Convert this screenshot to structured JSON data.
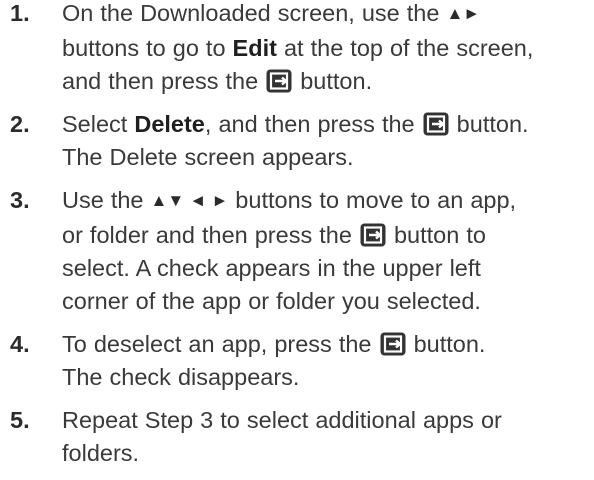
{
  "steps": [
    {
      "number": "1.",
      "lines": [
        {
          "a": "On the Downloaded screen, use the ",
          "arrows": "▲►"
        },
        {
          "a": "buttons to go to ",
          "bold": "Edit",
          "b": " at the top of the screen,"
        },
        {
          "a": "and then press the ",
          "icon": "enter-button-icon",
          "b": " button."
        }
      ]
    },
    {
      "number": "2.",
      "lines": [
        {
          "a": "Select ",
          "bold": "Delete",
          "b": ", and then press the ",
          "icon": "enter-button-icon",
          "c": " button."
        },
        {
          "a": "The Delete screen appears."
        }
      ]
    },
    {
      "number": "3.",
      "lines": [
        {
          "a": "Use the ",
          "arrows": "▲▼ ◄ ►",
          "b": " buttons to move to an app,"
        },
        {
          "a": "or folder and then press the ",
          "icon": "enter-button-icon",
          "b": " button to"
        },
        {
          "a": "select. A check appears in the upper left"
        },
        {
          "a": "corner of the app or folder you selected."
        }
      ]
    },
    {
      "number": "4.",
      "lines": [
        {
          "a": "To deselect an app, press the ",
          "icon": "enter-button-icon",
          "b": " button."
        },
        {
          "a": "The check disappears."
        }
      ]
    },
    {
      "number": "5.",
      "lines": [
        {
          "a": "Repeat Step 3 to select additional apps or"
        },
        {
          "a": "folders."
        }
      ]
    }
  ],
  "icon_color": "#333333"
}
